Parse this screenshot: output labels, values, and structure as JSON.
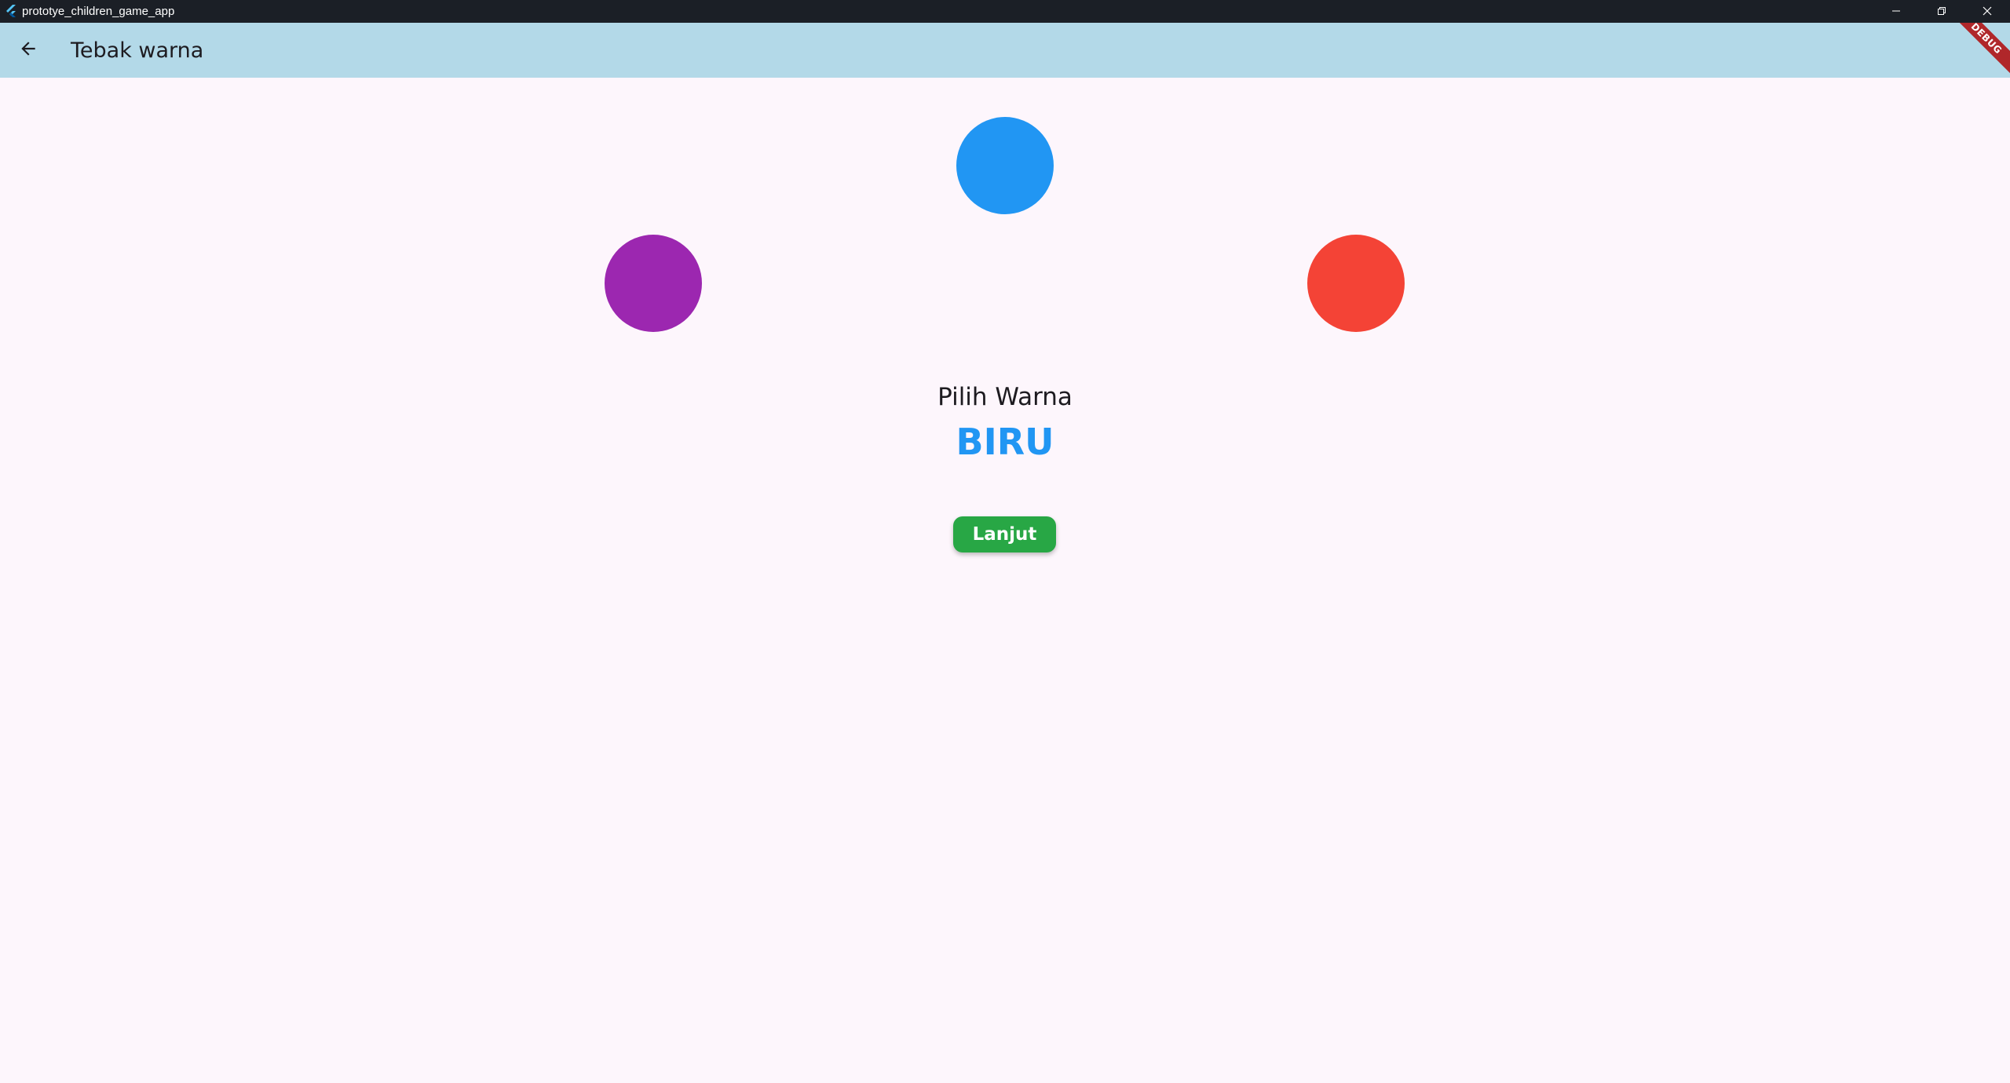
{
  "window": {
    "title": "prototye_children_game_app",
    "controls": {
      "minimize_icon": "minimize-icon",
      "restore_icon": "restore-icon",
      "close_icon": "close-icon"
    }
  },
  "appbar": {
    "title": "Tebak warna",
    "back_icon": "arrow-back-icon",
    "background": "#b3d9e8",
    "debug_banner": "DEBUG"
  },
  "game": {
    "choices": [
      {
        "name": "blue",
        "color": "#2196f3"
      },
      {
        "name": "purple",
        "color": "#9c27b0"
      },
      {
        "name": "red",
        "color": "#f44336"
      }
    ],
    "prompt": "Pilih Warna",
    "target_word": "BIRU",
    "target_color": "#2196f3",
    "next_label": "Lanjut",
    "next_color": "#28a745"
  },
  "colors": {
    "page_background": "#fdf6fc",
    "titlebar_background": "#1b1f26"
  }
}
